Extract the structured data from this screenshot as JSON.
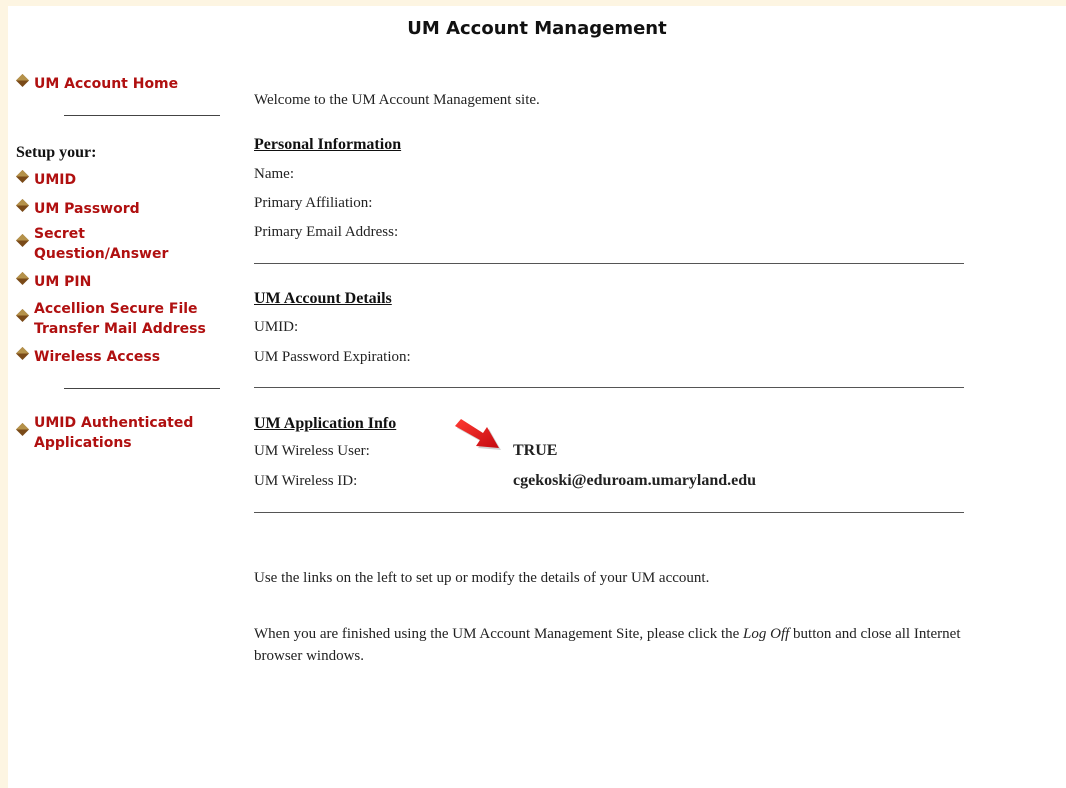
{
  "page": {
    "title": "UM Account Management"
  },
  "sidebar": {
    "home_label": "UM Account Home",
    "setup_label": "Setup your:",
    "items": [
      {
        "label": "UMID"
      },
      {
        "label": "UM Password"
      },
      {
        "label": "Secret Question/Answer"
      },
      {
        "label": "UM PIN"
      },
      {
        "label": "Accellion Secure File Transfer Mail Address"
      },
      {
        "label": "Wireless Access"
      }
    ],
    "apps_label": "UMID Authenticated Applications"
  },
  "main": {
    "welcome": "Welcome to the UM Account Management site.",
    "personal": {
      "heading": "Personal Information",
      "name_label": "Name:",
      "affiliation_label": "Primary Affiliation:",
      "email_label": "Primary Email Address:"
    },
    "account": {
      "heading": "UM Account Details",
      "umid_label": "UMID:",
      "expiration_label": "UM Password Expiration:"
    },
    "app_info": {
      "heading": "UM Application Info",
      "wireless_user_label": "UM Wireless User:",
      "wireless_user_value": "TRUE",
      "wireless_id_label": "UM Wireless ID:",
      "wireless_id_value": "cgekoski@eduroam.umaryland.edu"
    },
    "instructions": "Use the links on the left to set up or modify the details of your UM account.",
    "logoff_before": "When you are finished using the UM Account Management Site, please click the ",
    "logoff_em": "Log Off",
    "logoff_after": " button and close all Internet browser windows."
  },
  "colors": {
    "link": "#b01010",
    "bullet": "#7a4a18",
    "arrow": "#e0181c",
    "page_bg": "#fdf5e2"
  },
  "icons": {
    "bullet": "diamond-bullet-icon",
    "arrow": "red-arrow-icon"
  }
}
